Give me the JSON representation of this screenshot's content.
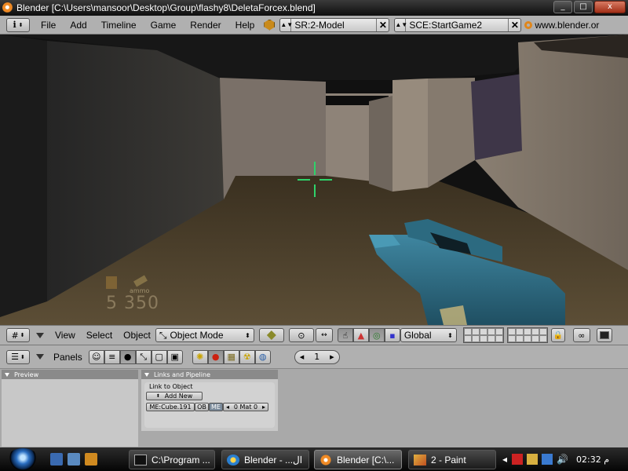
{
  "window": {
    "title": "Blender [C:\\Users\\mansoor\\Desktop\\Group\\flashy8\\DeletaForcex.blend]",
    "buttons": [
      "_",
      "□",
      "x"
    ]
  },
  "menubar": {
    "menus": [
      "File",
      "Add",
      "Timeline",
      "Game",
      "Render",
      "Help"
    ],
    "screen_field": "SR:2-Model",
    "scene_field": "SCE:StartGame2",
    "url": "www.blender.or"
  },
  "hud": {
    "label": "ammo",
    "value": "5  350"
  },
  "view_header": {
    "menus": [
      "View",
      "Select",
      "Object"
    ],
    "mode": "Object Mode",
    "orientation": "Global"
  },
  "panel_header": {
    "label": "Panels",
    "page": "1",
    "prev": "◂",
    "next": "▸"
  },
  "panels": {
    "preview": {
      "title": "Preview"
    },
    "links": {
      "title": "Links and Pipeline",
      "link_label": "Link to Object",
      "add_new": "Add New",
      "mesh_name": "ME:Cube.191",
      "ob": "OB",
      "me": "ME",
      "mat": "0 Mat 0"
    }
  },
  "taskbar": {
    "tasks": [
      {
        "label": "C:\\Program ..."
      },
      {
        "label": "Blender - ...ال"
      },
      {
        "label": "Blender [C:\\..."
      },
      {
        "label": "2 - Paint"
      }
    ],
    "clock": "02:32 م"
  },
  "colors": {
    "crosshair": "#2fd26a",
    "gun": "#2f6f86",
    "header_gray": "#b0b0b0"
  }
}
